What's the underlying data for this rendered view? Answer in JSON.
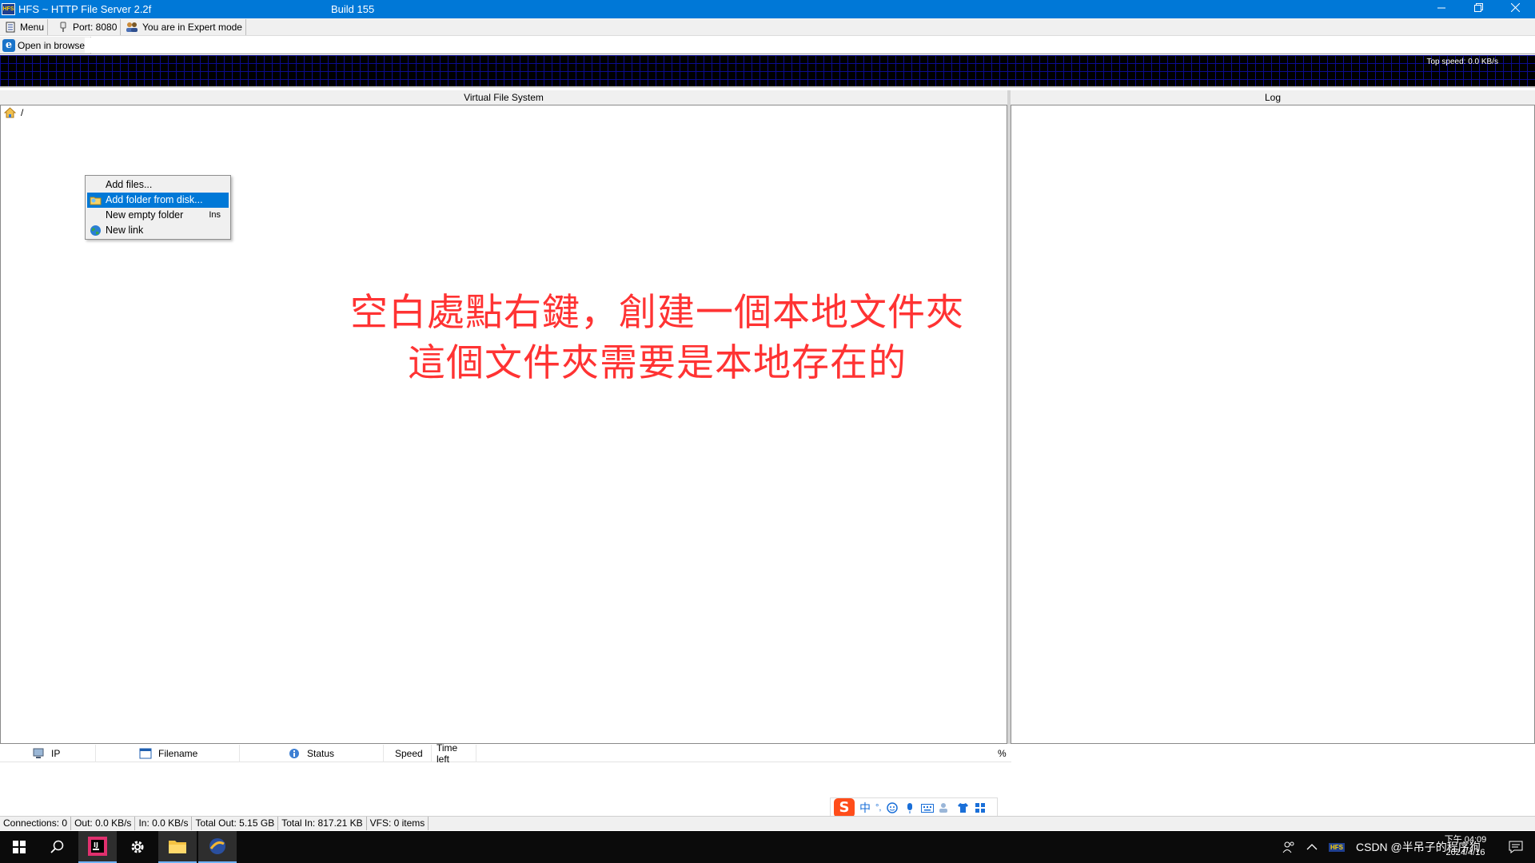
{
  "window": {
    "title": "HFS ~ HTTP File Server 2.2f",
    "build": "Build 155",
    "app_icon_text": "HFS"
  },
  "toolbar": {
    "menu_label": "Menu",
    "port_label": "Port: 8080",
    "mode_label": "You are in Expert mode"
  },
  "urlbar": {
    "open_browser_label": "Open in browser",
    "url_value": ""
  },
  "graph": {
    "top_speed": "Top speed: 0.0 KB/s"
  },
  "vfs": {
    "header": "Virtual File System",
    "root_label": "/"
  },
  "log": {
    "header": "Log"
  },
  "context_menu": {
    "items": [
      {
        "label": "Add files...",
        "shortcut": "",
        "icon": "none",
        "selected": false
      },
      {
        "label": "Add folder from disk...",
        "shortcut": "",
        "icon": "folder-icon",
        "selected": true
      },
      {
        "label": "New empty folder",
        "shortcut": "Ins",
        "icon": "none",
        "selected": false
      },
      {
        "label": "New link",
        "shortcut": "",
        "icon": "globe-icon",
        "selected": false
      }
    ]
  },
  "annotation": {
    "line1": "空白處點右鍵，創建一個本地文件夾",
    "line2": "這個文件夾需要是本地存在的",
    "color": "#ff3333"
  },
  "connections": {
    "columns": [
      "IP",
      "Filename",
      "Status",
      "Speed",
      "Time left",
      "%"
    ]
  },
  "ime": {
    "logo": "S",
    "lang": "中",
    "punct": "°,"
  },
  "statusbar": {
    "connections": "Connections: 0",
    "out": "Out: 0.0 KB/s",
    "in": "In: 0.0 KB/s",
    "total_out": "Total Out: 5.15 GB",
    "total_in": "Total In: 817.21 KB",
    "vfs": "VFS: 0 items"
  },
  "taskbar": {
    "watermark": "CSDN @半吊子的程序狗",
    "time": "下午 04:09",
    "date": "2024/4/16",
    "hfs_tray": "HFS"
  },
  "colors": {
    "titlebar": "#0078d7",
    "selection": "#0078d7",
    "graph_grid": "#0b0b8f",
    "annotation": "#ff3333"
  }
}
